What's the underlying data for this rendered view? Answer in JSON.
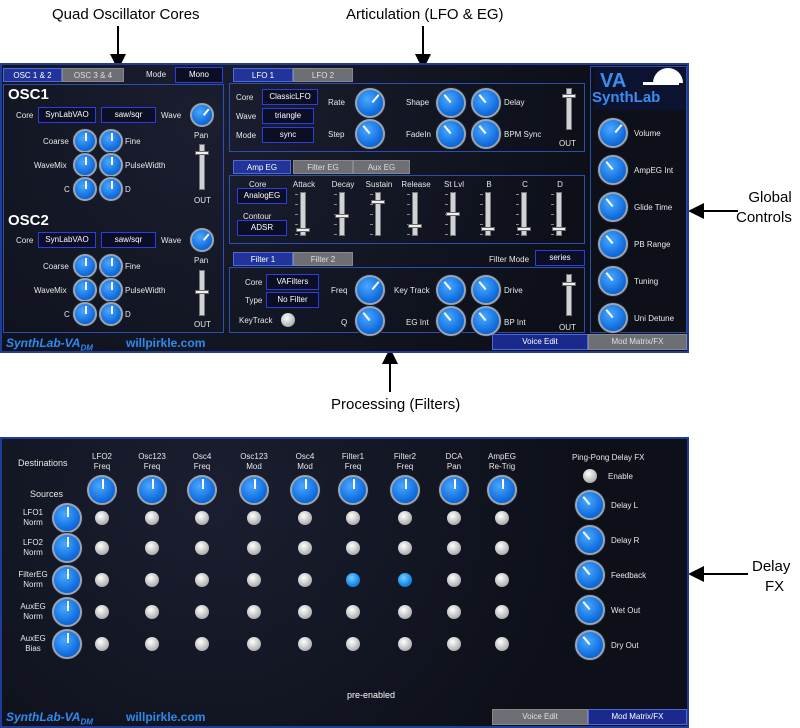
{
  "captions": {
    "osc": "Quad Oscillator Cores",
    "artic": "Articulation (LFO & EG)",
    "global": "Global\nControls",
    "global1": "Global",
    "global2": "Controls",
    "proc": "Processing (Filters)",
    "delay1": "Delay",
    "delay2": "FX",
    "pre": "pre-enabled"
  },
  "osc": {
    "tab1": "OSC 1 & 2",
    "tab2": "OSC 3 & 4",
    "mode_label": "Mode",
    "mode_value": "Mono",
    "osc1": {
      "title": "OSC1",
      "core_label": "Core",
      "core": "SynLabVAO",
      "wave_box": "saw/sqr",
      "wave": "Wave",
      "coarse": "Coarse",
      "fine": "Fine",
      "wavemix": "WaveMix",
      "pulsewidth": "PulseWidth",
      "c": "C",
      "d": "D",
      "pan": "Pan",
      "out": "OUT"
    },
    "osc2": {
      "title": "OSC2",
      "core_label": "Core",
      "core": "SynLabVAO",
      "wave_box": "saw/sqr",
      "wave": "Wave",
      "coarse": "Coarse",
      "fine": "Fine",
      "wavemix": "WaveMix",
      "pulsewidth": "PulseWidth",
      "c": "C",
      "d": "D",
      "pan": "Pan",
      "out": "OUT"
    }
  },
  "lfo": {
    "tab1": "LFO 1",
    "tab2": "LFO 2",
    "core_label": "Core",
    "core": "ClassicLFO",
    "wave_label": "Wave",
    "wave": "triangle",
    "mode_label": "Mode",
    "mode": "sync",
    "rate": "Rate",
    "step": "Step",
    "shape": "Shape",
    "fadein": "FadeIn",
    "delay": "Delay",
    "bpmsync": "BPM Sync",
    "out": "OUT"
  },
  "eg": {
    "tab1": "Amp EG",
    "tab2": "Filter EG",
    "tab3": "Aux EG",
    "core_label": "Core",
    "core": "AnalogEG",
    "contour_label": "Contour",
    "contour": "ADSR",
    "sliders": [
      "Attack",
      "Decay",
      "Sustain",
      "Release",
      "St Lvl",
      "B",
      "C",
      "D"
    ]
  },
  "filter": {
    "tab1": "Filter 1",
    "tab2": "Filter 2",
    "mode_label": "Filter Mode",
    "mode": "series",
    "core_label": "Core",
    "core": "VAFilters",
    "type_label": "Type",
    "type": "No Filter",
    "keytrack": "KeyTrack",
    "freq": "Freq",
    "q": "Q",
    "keytrack2": "Key Track",
    "egint": "EG Int",
    "drive": "Drive",
    "bpint": "BP Int",
    "out": "OUT"
  },
  "global": {
    "logo1": "VA",
    "logo2": "SynthLab",
    "knobs": [
      "Volume",
      "AmpEG Int",
      "Glide Time",
      "PB Range",
      "Tuning",
      "Uni Detune"
    ]
  },
  "footer": {
    "brand": "SynthLab-VA",
    "sub": "DM",
    "site": "willpirkle.com",
    "voice_edit": "Voice Edit",
    "mod_matrix": "Mod Matrix/FX"
  },
  "matrix": {
    "destinations": "Destinations",
    "sources": "Sources",
    "dest": [
      [
        "LFO2",
        "Freq"
      ],
      [
        "Osc123",
        "Freq"
      ],
      [
        "Osc4",
        "Freq"
      ],
      [
        "Osc123",
        "Mod"
      ],
      [
        "Osc4",
        "Mod"
      ],
      [
        "Filter1",
        "Freq"
      ],
      [
        "Filter2",
        "Freq"
      ],
      [
        "DCA",
        "Pan"
      ],
      [
        "AmpEG",
        "Re-Trig"
      ]
    ],
    "src": [
      [
        "LFO1",
        "Norm"
      ],
      [
        "LFO2",
        "Norm"
      ],
      [
        "FilterEG",
        "Norm"
      ],
      [
        "AuxEG",
        "Norm"
      ],
      [
        "AuxEG",
        "Bias"
      ]
    ],
    "enabled": [
      [
        2,
        5
      ],
      [
        2,
        6
      ]
    ]
  },
  "delay": {
    "title": "Ping-Pong Delay FX",
    "enable": "Enable",
    "knobs": [
      "Delay L",
      "Delay R",
      "Feedback",
      "Wet Out",
      "Dry Out"
    ]
  },
  "colors": {
    "panel": "#101320",
    "border": "#1f3c99",
    "accent": "#1a7ee8",
    "tab_active": "#22339a",
    "tab_inactive": "#6d6f75"
  }
}
